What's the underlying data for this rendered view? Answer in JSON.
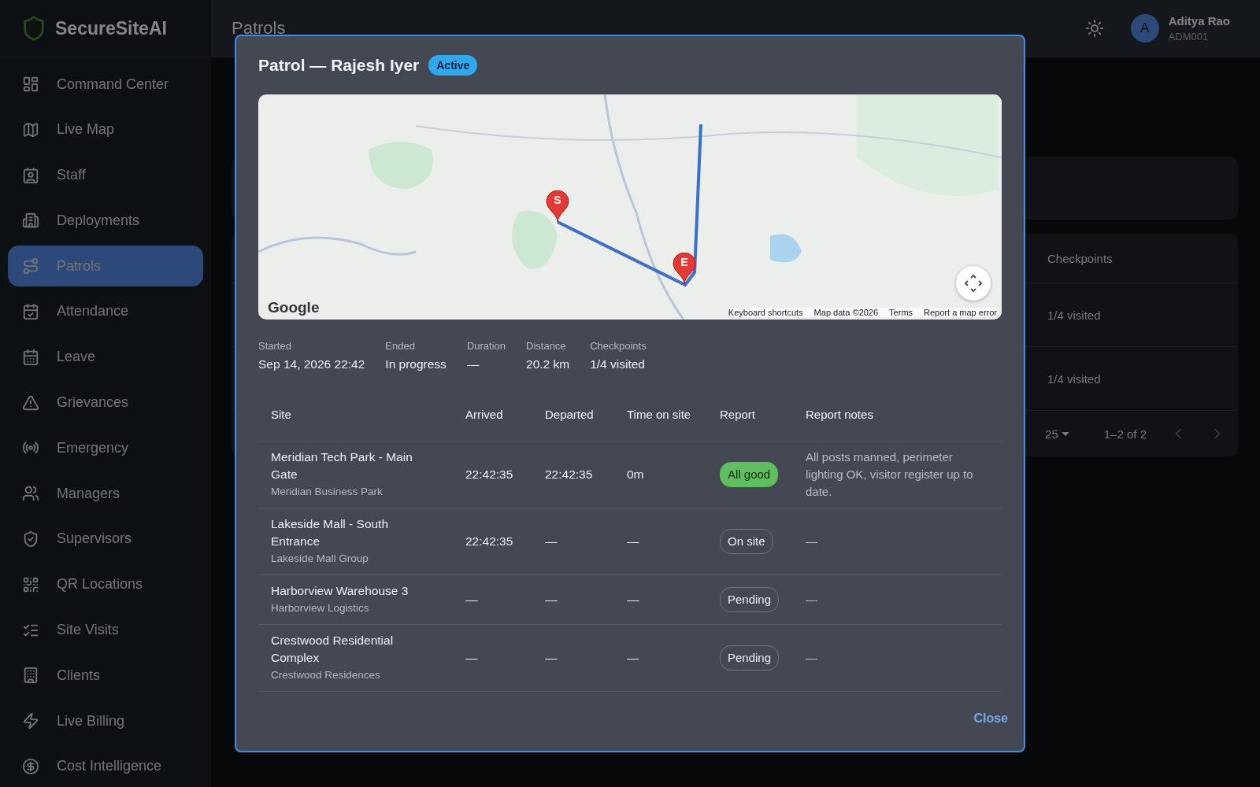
{
  "app": {
    "name": "SecureSiteAI"
  },
  "sidebar": {
    "items": [
      {
        "label": "Command Center",
        "selected": false
      },
      {
        "label": "Live Map",
        "selected": false
      },
      {
        "label": "Staff",
        "selected": false
      },
      {
        "label": "Deployments",
        "selected": false
      },
      {
        "label": "Patrols",
        "selected": true
      },
      {
        "label": "Attendance",
        "selected": false
      },
      {
        "label": "Leave",
        "selected": false
      },
      {
        "label": "Grievances",
        "selected": false
      },
      {
        "label": "Emergency",
        "selected": false
      },
      {
        "label": "Managers",
        "selected": false
      },
      {
        "label": "Supervisors",
        "selected": false
      },
      {
        "label": "QR Locations",
        "selected": false
      },
      {
        "label": "Site Visits",
        "selected": false
      },
      {
        "label": "Clients",
        "selected": false
      },
      {
        "label": "Live Billing",
        "selected": false
      },
      {
        "label": "Cost Intelligence",
        "selected": false
      }
    ]
  },
  "header": {
    "title": "Patrols",
    "user": {
      "initial": "A",
      "name": "Aditya Rao",
      "id": "ADM001"
    }
  },
  "background_table": {
    "columns": [
      "Checkpoints"
    ],
    "rows": [
      [
        "1/4 visited"
      ],
      [
        "1/4 visited"
      ]
    ],
    "pagination": {
      "rows_per_page": "25",
      "range": "1–2 of 2"
    }
  },
  "dialog": {
    "title": "Patrol — Rajesh Iyer",
    "status": "Active",
    "map": {
      "markers": [
        {
          "label": "S"
        },
        {
          "label": "E"
        }
      ],
      "logo": "Google",
      "attribution": [
        "Keyboard shortcuts",
        "Map data ©2026",
        "Terms",
        "Report a map error"
      ]
    },
    "stats": [
      {
        "label": "Started",
        "value": "Sep 14, 2026 22:42"
      },
      {
        "label": "Ended",
        "value": "In progress"
      },
      {
        "label": "Duration",
        "value": "—"
      },
      {
        "label": "Distance",
        "value": "20.2 km"
      },
      {
        "label": "Checkpoints",
        "value": "1/4 visited"
      }
    ],
    "table": {
      "columns": [
        "Site",
        "Arrived",
        "Departed",
        "Time on site",
        "Report",
        "Report notes"
      ],
      "rows": [
        {
          "site": "Meridian Tech Park - Main Gate",
          "client": "Meridian Business Park",
          "arrived": "22:42:35",
          "departed": "22:42:35",
          "time_on_site": "0m",
          "report": {
            "label": "All good",
            "kind": "good"
          },
          "notes": "All posts manned, perimeter lighting OK, visitor register up to date."
        },
        {
          "site": "Lakeside Mall - South Entrance",
          "client": "Lakeside Mall Group",
          "arrived": "22:42:35",
          "departed": "—",
          "time_on_site": "—",
          "report": {
            "label": "On site",
            "kind": "neutral"
          },
          "notes": "—"
        },
        {
          "site": "Harborview Warehouse 3",
          "client": "Harborview Logistics",
          "arrived": "—",
          "departed": "—",
          "time_on_site": "—",
          "report": {
            "label": "Pending",
            "kind": "neutral"
          },
          "notes": "—"
        },
        {
          "site": "Crestwood Residential Complex",
          "client": "Crestwood Residences",
          "arrived": "—",
          "departed": "—",
          "time_on_site": "—",
          "report": {
            "label": "Pending",
            "kind": "neutral"
          },
          "notes": "—"
        }
      ]
    },
    "close": "Close"
  }
}
